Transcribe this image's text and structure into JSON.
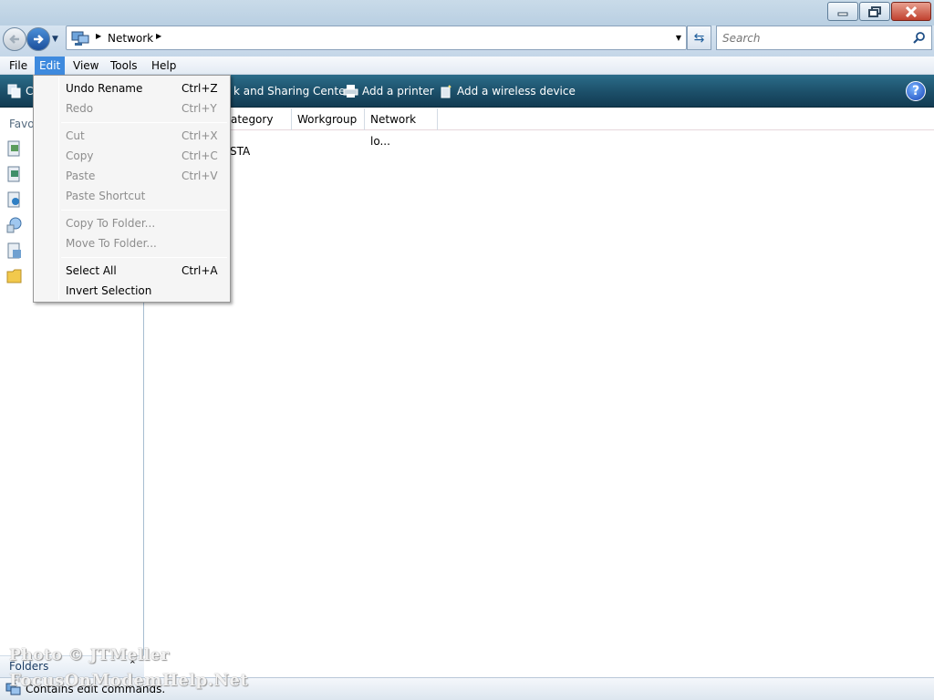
{
  "window": {
    "minimize_icon": "minimize-icon",
    "maximize_icon": "restore-icon",
    "close_icon": "close-icon",
    "close_color": "#c1422f"
  },
  "navigation": {
    "back_icon": "back-arrow-icon",
    "forward_icon": "forward-arrow-icon",
    "history_icon": "chevron-down-icon"
  },
  "address": {
    "crumb": "Network",
    "location_icon": "network-computer-icon"
  },
  "search": {
    "placeholder": "Search"
  },
  "menubar": {
    "items": [
      "File",
      "Edit",
      "View",
      "Tools",
      "Help"
    ],
    "active": "Edit"
  },
  "toolbar": {
    "items": [
      {
        "label": "C",
        "icon": "network-items-icon"
      },
      {
        "label": "k and Sharing Center",
        "icon": "sharing-center-icon"
      },
      {
        "label": "Add a printer",
        "icon": "printer-icon"
      },
      {
        "label": "Add a wireless device",
        "icon": "wireless-device-icon"
      }
    ],
    "help_label": "?",
    "accent_color": "#1c4f69"
  },
  "navpane": {
    "favorites_label": "Favo",
    "links": [
      {
        "icon": "documents-icon"
      },
      {
        "icon": "pictures-icon"
      },
      {
        "icon": "music-icon"
      },
      {
        "icon": "searches-icon"
      },
      {
        "icon": "public-icon"
      },
      {
        "icon": "folder-icon"
      }
    ],
    "folders_label": "Folders",
    "folders_chevron": "⌃"
  },
  "content": {
    "columns": [
      "ategory",
      "Workgroup",
      "Network lo..."
    ],
    "items": [
      "STA"
    ]
  },
  "edit_menu": {
    "items": [
      {
        "label": "Undo Rename",
        "shortcut": "Ctrl+Z",
        "enabled": true
      },
      {
        "label": "Redo",
        "shortcut": "Ctrl+Y",
        "enabled": false
      },
      {
        "label": "Cut",
        "shortcut": "Ctrl+X",
        "enabled": false
      },
      {
        "label": "Copy",
        "shortcut": "Ctrl+C",
        "enabled": false
      },
      {
        "label": "Paste",
        "shortcut": "Ctrl+V",
        "enabled": false
      },
      {
        "label": "Paste Shortcut",
        "shortcut": "",
        "enabled": false
      },
      {
        "label": "Copy To Folder...",
        "shortcut": "",
        "enabled": false
      },
      {
        "label": "Move To Folder...",
        "shortcut": "",
        "enabled": false
      },
      {
        "label": "Select All",
        "shortcut": "Ctrl+A",
        "enabled": true
      },
      {
        "label": "Invert Selection",
        "shortcut": "",
        "enabled": true
      }
    ]
  },
  "status": {
    "text": "Contains edit commands.",
    "icon": "network-status-icon"
  },
  "watermark": {
    "line1": "Photo © JTMeller",
    "line2": "FocusOnModemHelp.Net"
  }
}
